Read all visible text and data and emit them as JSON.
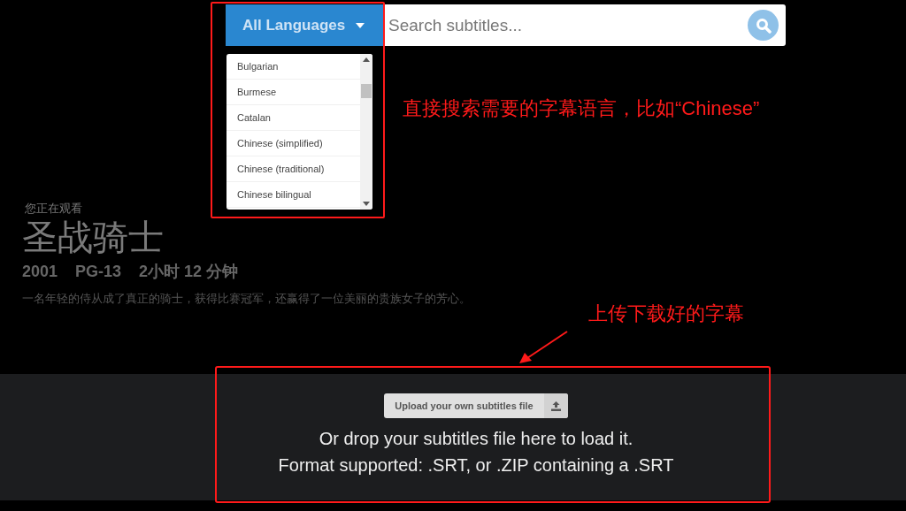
{
  "language_select": {
    "label": "All Languages",
    "expanded": true,
    "options": [
      {
        "label": "Bulgarian"
      },
      {
        "label": "Burmese"
      },
      {
        "label": "Catalan"
      },
      {
        "label": "Chinese (simplified)"
      },
      {
        "label": "Chinese (traditional)"
      },
      {
        "label": "Chinese bilingual"
      }
    ]
  },
  "search": {
    "placeholder": "Search subtitles..."
  },
  "now_watching": {
    "caption": "您正在观看",
    "title": "圣战骑士",
    "meta": [
      "2001",
      "PG-13",
      "2小时 12 分钟"
    ],
    "synopsis": "一名年轻的侍从成了真正的骑士，获得比赛冠军，还赢得了一位美丽的贵族女子的芳心。"
  },
  "upload": {
    "button": "Upload your own subtitles file",
    "lines": [
      "Or drop your subtitles file here to load it.",
      "Format supported: .SRT, or .ZIP containing a .SRT"
    ]
  },
  "annotations": [
    {
      "text": "直接搜索需要的字幕语言，比如“Chinese”"
    },
    {
      "text": "上传下载好的字幕"
    }
  ]
}
